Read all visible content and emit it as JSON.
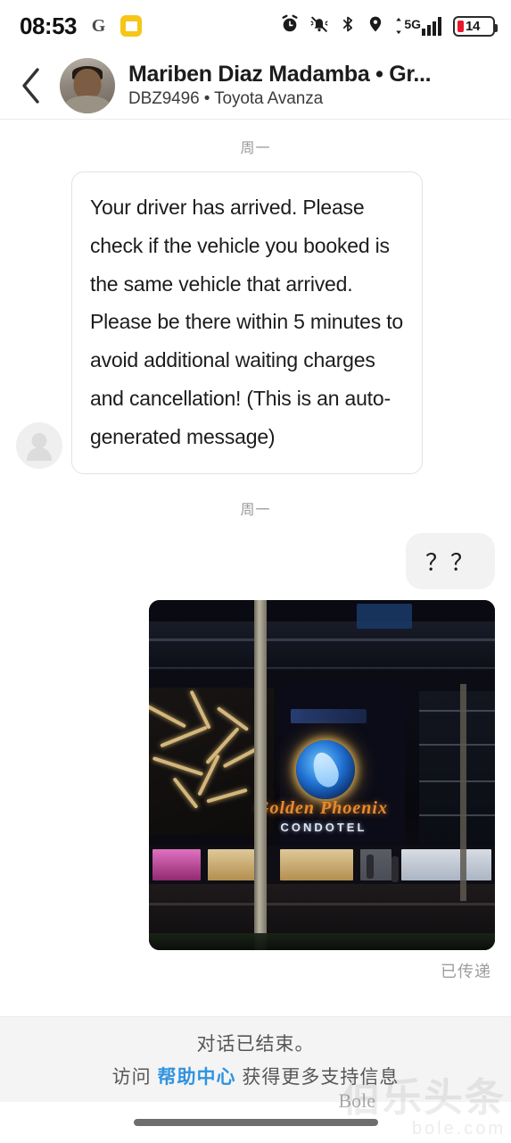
{
  "status_bar": {
    "time": "08:53",
    "icons_left": [
      "google-g-icon",
      "yellow-app-icon"
    ],
    "icons_right": [
      "alarm-icon",
      "bell-muted-icon",
      "bluetooth-icon",
      "location-icon",
      "signal-5g-icon"
    ],
    "network_label": "5G",
    "battery_level": "14",
    "battery_color": "#e8192c"
  },
  "header": {
    "back_icon": "back-chevron-icon",
    "title": "Mariben Diaz Madamba • Gr...",
    "subtitle": "DBZ9496 • Toyota Avanza",
    "avatar": "contact-photo-avatar"
  },
  "conversation": {
    "day_separator_1": "周一",
    "day_separator_2": "周一",
    "incoming_message": "Your driver has arrived. Please check if the vehicle you booked is the same vehicle that arrived. Please be there within 5 minutes to avoid additional waiting charges and cancellation! (This is an auto-generated message)",
    "outgoing_message": "？？",
    "photo": {
      "description": "night-time-street-photo",
      "sign_brand": "Golden Phoenix",
      "sign_subtitle": "CONDOTEL"
    },
    "delivery_status": "已传递"
  },
  "footer": {
    "line1": "对话已结束。",
    "line2_prefix": "访问 ",
    "link": "帮助中心",
    "line2_suffix": " 获得更多支持信息",
    "link_color": "#2f93e0"
  },
  "watermark": {
    "cn": "伯乐头条",
    "en": "bole.com",
    "latin": "Bole"
  },
  "nav": {
    "gesture_pill": "home-gesture-pill"
  }
}
